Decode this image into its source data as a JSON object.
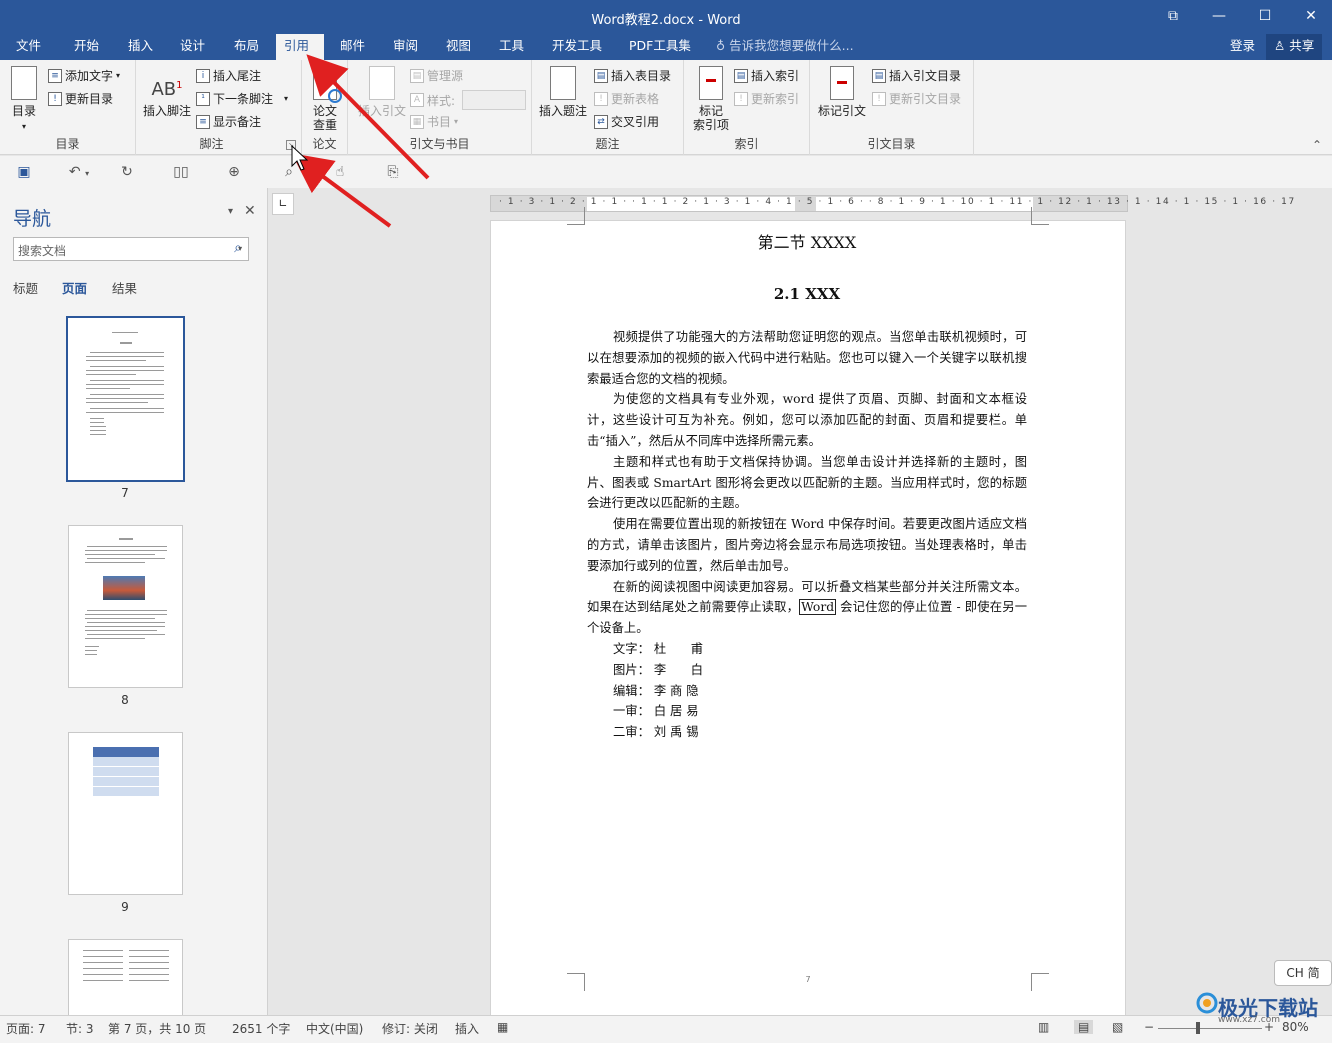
{
  "window": {
    "title": "Word教程2.docx - Word",
    "restore_icon": "restore-icon",
    "min_label": "—",
    "max_label": "☐",
    "close_label": "✕"
  },
  "tabs": [
    "文件",
    "开始",
    "插入",
    "设计",
    "布局",
    "引用",
    "邮件",
    "审阅",
    "视图",
    "工具",
    "开发工具",
    "PDF工具集"
  ],
  "tell_me": "告诉我您想要做什么...",
  "login": "登录",
  "share": "共享",
  "ribbon": {
    "toc": {
      "big": "目录",
      "add_text": "添加文字",
      "update": "更新目录",
      "group": "目录"
    },
    "footnote": {
      "big": "插入脚注",
      "insert_end": "插入尾注",
      "next": "下一条脚注",
      "show": "显示备注",
      "group": "脚注"
    },
    "paper": {
      "big1": "论文",
      "big2": "查重",
      "group": "论文"
    },
    "citation": {
      "big": "插入引文",
      "manage": "管理源",
      "style": "样式:",
      "biblio": "书目",
      "group": "引文与书目"
    },
    "caption": {
      "big": "插入题注",
      "insert_table": "插入表目录",
      "update_table": "更新表格",
      "cross_ref": "交叉引用",
      "group": "题注"
    },
    "index": {
      "big1": "标记",
      "big2": "索引项",
      "insert": "插入索引",
      "update": "更新索引",
      "group": "索引"
    },
    "authorities": {
      "big": "标记引文",
      "insert": "插入引文目录",
      "update": "更新引文目录",
      "group": "引文目录"
    }
  },
  "nav": {
    "title": "导航",
    "search_placeholder": "搜索文档",
    "tabs": [
      "标题",
      "页面",
      "结果"
    ],
    "pages": [
      "7",
      "8",
      "9"
    ]
  },
  "document": {
    "heading1": "第二节  XXXX",
    "heading2": "2.1 XXX",
    "paragraphs": [
      "视频提供了功能强大的方法帮助您证明您的观点。当您单击联机视频时，可以在想要添加的视频的嵌入代码中进行粘贴。您也可以键入一个关键字以联机搜索最适合您的文档的视频。",
      "为使您的文档具有专业外观，word 提供了页眉、页脚、封面和文本框设计，这些设计可互为补充。例如，您可以添加匹配的封面、页眉和提要栏。单击“插入”，然后从不同库中选择所需元素。",
      "主题和样式也有助于文档保持协调。当您单击设计并选择新的主题时，图片、图表或 SmartArt 图形将会更改以匹配新的主题。当应用样式时，您的标题会进行更改以匹配新的主题。",
      "使用在需要位置出现的新按钮在 Word 中保存时间。若要更改图片适应文档的方式，请单击该图片，图片旁边将会显示布局选项按钮。当处理表格时，单击要添加行或列的位置，然后单击加号。"
    ],
    "para5_a": "在新的阅读视图中阅读更加容易。可以折叠文档某些部分并关注所需文本。如果在达到结尾处之前需要停止读取，",
    "para5_boxed": "Word",
    "para5_b": " 会记住您的停止位置 - 即使在另一个设备上。",
    "credits": [
      {
        "role": "文字：",
        "name": "杜　　甫"
      },
      {
        "role": "图片：",
        "name": "李　　白"
      },
      {
        "role": "编辑：",
        "name": "李 商 隐"
      },
      {
        "role": "一审：",
        "name": "白 居 易"
      },
      {
        "role": "二审：",
        "name": "刘 禹 锡"
      }
    ],
    "page_footer": "7"
  },
  "status": {
    "page": "页面: 7",
    "section": "节: 3",
    "page_of": "第 7 页，共 10 页",
    "words": "2651 个字",
    "lang": "中文(中国)",
    "track": "修订: 关闭",
    "insert": "插入",
    "zoom": "80%"
  },
  "ime": "CH 简",
  "watermark": {
    "name": "极光下载站",
    "url": "www.xz7.com"
  },
  "ruler_text": "· 1 · 3 · 1 · 2 · 1 · 1 ·  · 1 · 1 · 2 · 1 · 3 · 1 · 4 · 1 · 5 · 1 · 6 ·   · 8 · 1 · 9 · 1 · 10 · 1 · 11 · 1 · 12 · 1 · 13 · 1 · 14 · 1 · 15 · 1 · 16 · 17"
}
